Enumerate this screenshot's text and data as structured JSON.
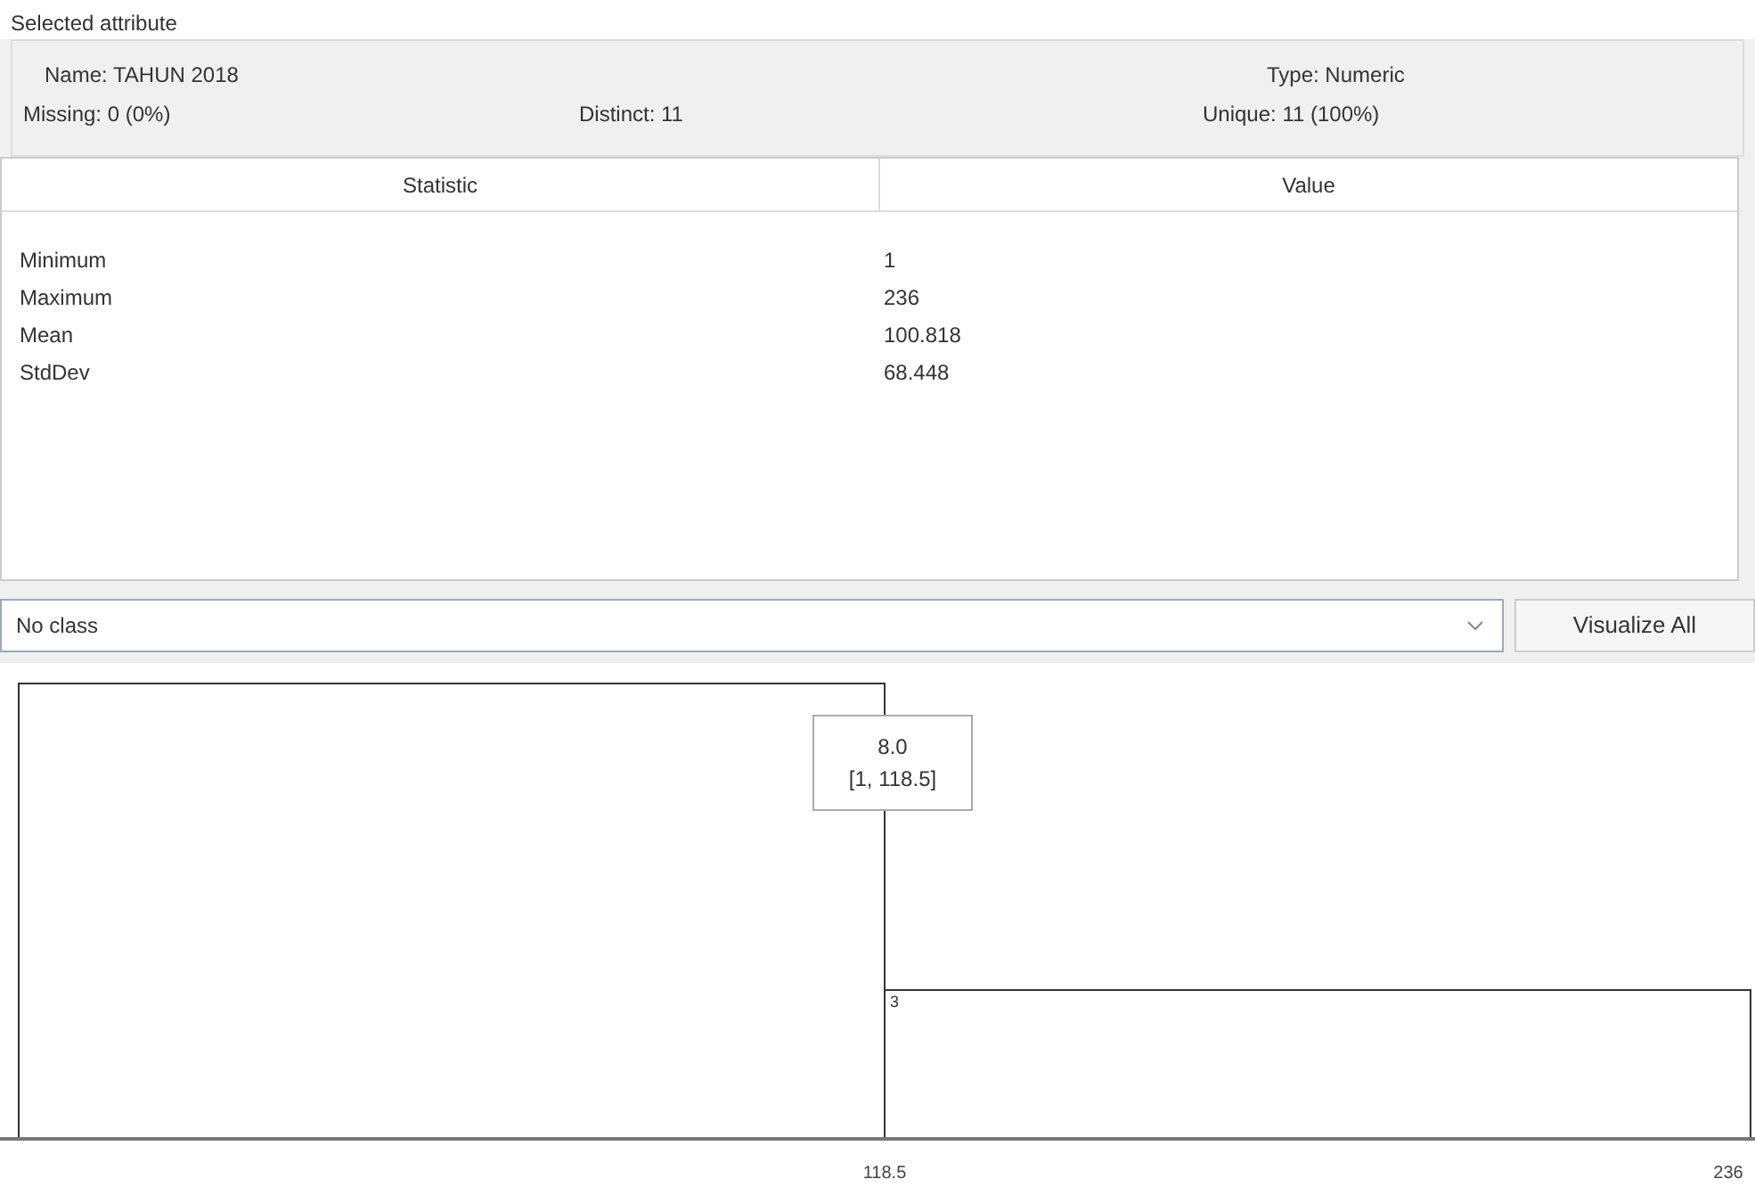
{
  "selected_attribute": {
    "title": "Selected attribute",
    "name": "Name: TAHUN 2018",
    "type": "Type: Numeric",
    "missing": "Missing: 0 (0%)",
    "distinct": "Distinct: 11",
    "unique": "Unique: 11 (100%)"
  },
  "table": {
    "columns": [
      "Statistic",
      "Value"
    ],
    "rows": [
      [
        "Minimum",
        "1"
      ],
      [
        "Maximum",
        "236"
      ],
      [
        "Mean",
        "100.818"
      ],
      [
        "StdDev",
        "68.448"
      ]
    ]
  },
  "class_dropdown": {
    "value": "No class"
  },
  "visualize_button": "Visualize All",
  "histogram": {
    "bar_labels": [
      "3"
    ],
    "x_labels": [
      "118.5",
      "236"
    ],
    "tooltip": {
      "value": "8.0",
      "range": "[1, 118.5]"
    }
  }
}
